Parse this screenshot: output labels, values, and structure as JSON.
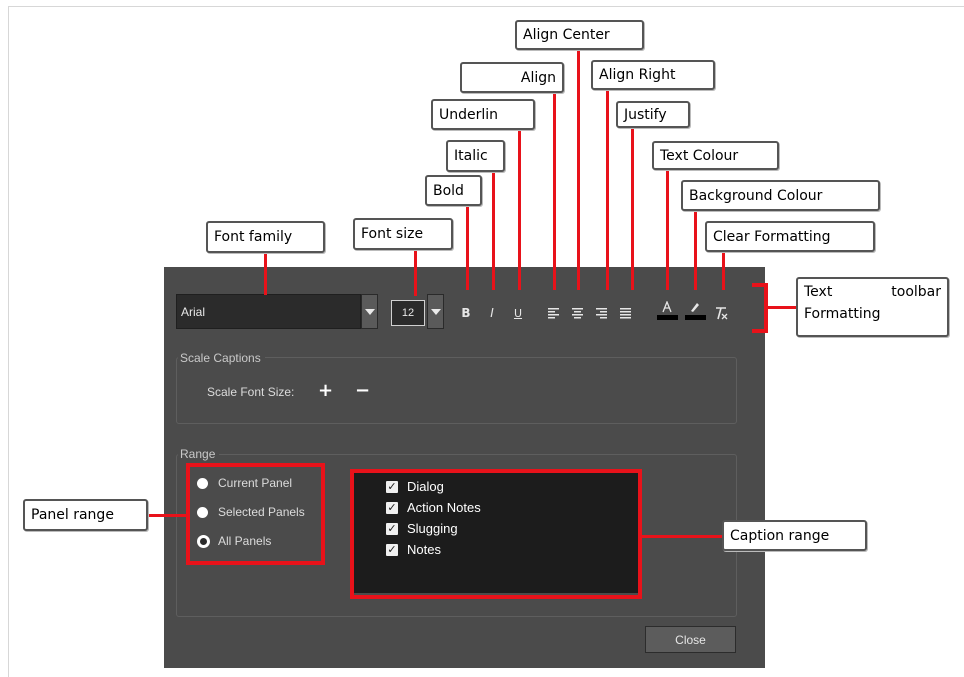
{
  "callouts": {
    "font_family": "Font family",
    "font_size": "Font size",
    "bold": "Bold",
    "italic": "Italic",
    "underline": "Underlin",
    "align": "Align",
    "align_center": "Align Center",
    "align_right": "Align Right",
    "justify": "Justify",
    "text_colour": "Text Colour",
    "background_colour": "Background Colour",
    "clear_formatting": "Clear Formatting",
    "toolbar_line1": "Text Formatting",
    "toolbar_line2": "toolbar",
    "panel_range": "Panel range",
    "caption_range": "Caption range"
  },
  "toolbar": {
    "font_family_value": "Arial",
    "font_size_value": "12",
    "bold_glyph": "B",
    "italic_glyph": "I",
    "underline_glyph": "U"
  },
  "scale_captions": {
    "title": "Scale Captions",
    "label": "Scale Font Size:",
    "increase": "+",
    "decrease": "−"
  },
  "range": {
    "title": "Range",
    "panel_options": [
      {
        "label": "Current Panel",
        "selected": false
      },
      {
        "label": "Selected Panels",
        "selected": false
      },
      {
        "label": "All Panels",
        "selected": true
      }
    ],
    "caption_options": [
      {
        "label": "Dialog",
        "checked": true
      },
      {
        "label": "Action Notes",
        "checked": true
      },
      {
        "label": "Slugging",
        "checked": true
      },
      {
        "label": "Notes",
        "checked": true
      }
    ]
  },
  "buttons": {
    "close": "Close"
  },
  "colors": {
    "dialog_bg": "#4b4b4b",
    "highlight_red": "#e8121a",
    "caption_box_bg": "#1c1c1c"
  }
}
